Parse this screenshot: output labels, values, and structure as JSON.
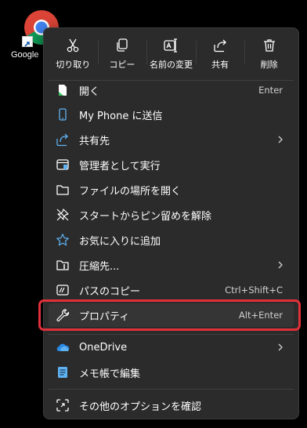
{
  "desktop": {
    "icon_label": "Google"
  },
  "toolbar": {
    "cut_label": "切り取り",
    "copy_label": "コピー",
    "rename_label": "名前の変更",
    "share_label": "共有",
    "delete_label": "削除"
  },
  "items": [
    {
      "label": "開く",
      "shortcut": "Enter",
      "icon": "file-open-icon"
    },
    {
      "label": "My Phone に送信",
      "icon": "phone-icon"
    },
    {
      "label": "共有先",
      "icon": "share-to-icon",
      "submenu": true
    },
    {
      "label": "管理者として実行",
      "icon": "shield-icon"
    },
    {
      "label": "ファイルの場所を開く",
      "icon": "folder-icon"
    },
    {
      "label": "スタートからピン留めを解除",
      "icon": "unpin-icon"
    },
    {
      "label": "お気に入りに追加",
      "icon": "star-icon"
    },
    {
      "label": "圧縮先...",
      "icon": "zip-folder-icon",
      "submenu": true
    },
    {
      "label": "パスのコピー",
      "shortcut": "Ctrl+Shift+C",
      "icon": "copy-path-icon"
    },
    {
      "label": "プロパティ",
      "shortcut": "Alt+Enter",
      "icon": "wrench-icon"
    },
    {
      "label": "OneDrive",
      "icon": "onedrive-icon",
      "submenu": true
    },
    {
      "label": "メモ帳で編集",
      "icon": "notepad-icon"
    },
    {
      "label": "その他のオプションを確認",
      "icon": "more-options-icon"
    }
  ],
  "colors": {
    "menu_bg": "#2b2b2b",
    "highlight_border": "#e0303a",
    "accent_blue": "#5fb2f2"
  }
}
